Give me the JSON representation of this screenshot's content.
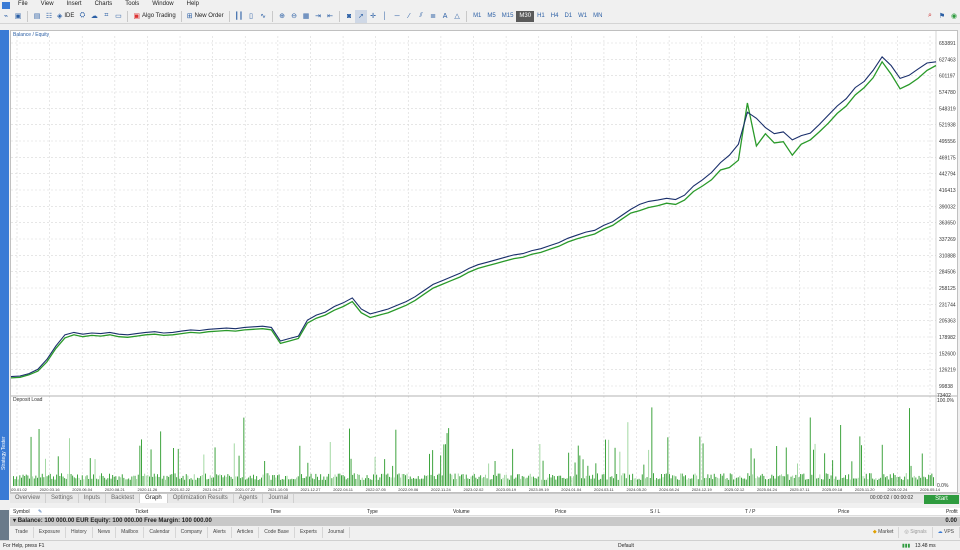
{
  "menu": [
    "File",
    "View",
    "Insert",
    "Charts",
    "Tools",
    "Window",
    "Help"
  ],
  "toolbar": {
    "algo_trading": "Algo Trading",
    "new_order": "New Order",
    "ide": "IDE",
    "timeframes": [
      "M1",
      "M5",
      "M15",
      "M30",
      "H1",
      "H4",
      "D1",
      "W1",
      "MN"
    ],
    "active_timeframe": "M30"
  },
  "side_tab": "Strategy Tester",
  "graph": {
    "series_label": "Balance / Equity",
    "deposit_label": "Deposit Load",
    "deposit_top": "100.0%",
    "deposit_bottom": "0.0%",
    "deposit_axis_value": "73402"
  },
  "chart_data": {
    "type": "line",
    "ylim": [
      73402,
      653891
    ],
    "y_ticks": [
      "653891",
      "627463",
      "601197",
      "574780",
      "548319",
      "521938",
      "495556",
      "469175",
      "442794",
      "416413",
      "390032",
      "363650",
      "337269",
      "310888",
      "284506",
      "258125",
      "231744",
      "205363",
      "178982",
      "152600",
      "126219",
      "99838"
    ],
    "x_ticks": [
      "2020.01.02",
      "2020.03.16",
      "2020.06.04",
      "2020.08.21",
      "2020.11.26",
      "2021.02.22",
      "2021.04.27",
      "2021.07.22",
      "2021.10.05",
      "2021.12.27",
      "2022.04.11",
      "2022.07.05",
      "2022.09.06",
      "2022.11.24",
      "2023.02.02",
      "2023.05.19",
      "2023.09.19",
      "2024.01.04",
      "2024.03.11",
      "2024.05.20",
      "2024.08.24",
      "2024.12.19",
      "2025.02.12",
      "2025.04.24",
      "2025.07.11",
      "2025.09.18",
      "2025.11.20",
      "2026.02.24",
      "2026.05.14"
    ],
    "series": [
      {
        "name": "Balance",
        "color": "#1a2f6b",
        "values": [
          100000,
          101000,
          105000,
          112000,
          128000,
          150000,
          168000,
          172000,
          169000,
          171000,
          170000,
          172000,
          169000,
          168000,
          170000,
          172000,
          173000,
          171000,
          172000,
          174000,
          176000,
          175000,
          177000,
          178000,
          179000,
          178000,
          180000,
          181000,
          182000,
          180000,
          158000,
          162000,
          166000,
          192000,
          200000,
          205000,
          214000,
          220000,
          228000,
          210000,
          202000,
          206000,
          210000,
          216000,
          222000,
          230000,
          240000,
          250000,
          256000,
          262000,
          268000,
          276000,
          282000,
          286000,
          290000,
          294000,
          298000,
          300000,
          305000,
          308000,
          313000,
          318000,
          325000,
          330000,
          335000,
          338000,
          346000,
          352000,
          362000,
          372000,
          380000,
          385000,
          387000,
          390000,
          388000,
          395000,
          410000,
          420000,
          432000,
          448000,
          460000,
          478000,
          530000,
          520000,
          505000,
          495000,
          498000,
          485000,
          492000,
          496000,
          510000,
          525000,
          540000,
          552000,
          570000,
          580000,
          598000,
          620000,
          606000,
          585000,
          590000,
          600000,
          610000,
          612000
        ]
      },
      {
        "name": "Equity",
        "color": "#2a9a2a",
        "values": [
          98000,
          99000,
          103000,
          109000,
          124000,
          146000,
          163000,
          168000,
          165000,
          167000,
          166000,
          168000,
          165000,
          164000,
          166000,
          168000,
          169000,
          167000,
          168000,
          170000,
          172000,
          171000,
          173000,
          174000,
          175000,
          174000,
          176000,
          177000,
          178000,
          176000,
          154000,
          158000,
          162000,
          187000,
          195000,
          200000,
          208000,
          214000,
          222000,
          204000,
          196000,
          200000,
          204000,
          210000,
          216000,
          224000,
          234000,
          244000,
          250000,
          256000,
          262000,
          270000,
          276000,
          280000,
          284000,
          288000,
          292000,
          294000,
          299000,
          302000,
          307000,
          312000,
          319000,
          324000,
          328000,
          332000,
          340000,
          346000,
          356000,
          366000,
          370000,
          375000,
          378000,
          382000,
          380000,
          387000,
          401000,
          410000,
          420000,
          436000,
          440000,
          452000,
          545000,
          475000,
          495000,
          480000,
          482000,
          460000,
          478000,
          485000,
          498000,
          512000,
          528000,
          540000,
          558000,
          570000,
          586000,
          612000,
          592000,
          568000,
          575000,
          585000,
          598000,
          606000
        ]
      }
    ],
    "grid": true
  },
  "tabs": [
    "Overview",
    "Settings",
    "Inputs",
    "Backtest",
    "Graph",
    "Optimization Results",
    "Agents",
    "Journal"
  ],
  "active_tab": "Graph",
  "timer": "00:00:02 / 00:00:02",
  "start_button": "Start",
  "trade_columns": [
    "Symbol",
    "Ticket",
    "Time",
    "Type",
    "Volume",
    "Price",
    "S / L",
    "T / P",
    "Price",
    "Profit"
  ],
  "balance_line": "Balance: 100 000.00 EUR  Equity: 100 000.00  Free Margin: 100 000.00",
  "balance_profit": "0.00",
  "bottom_tabs": [
    "Trade",
    "Exposure",
    "History",
    "News",
    "Mailbox",
    "Calendar",
    "Company",
    "Alerts",
    "Articles",
    "Code Base",
    "Experts",
    "Journal"
  ],
  "bottom_right": {
    "market": "Market",
    "signals": "Signals",
    "vps": "VPS"
  },
  "status": {
    "help": "For Help, press F1",
    "profile": "Default",
    "connection": "13.48 ms"
  },
  "colors": {
    "accent": "#3a7bd5",
    "start": "#2e9b3e",
    "deposit": "#2a9a2a"
  }
}
